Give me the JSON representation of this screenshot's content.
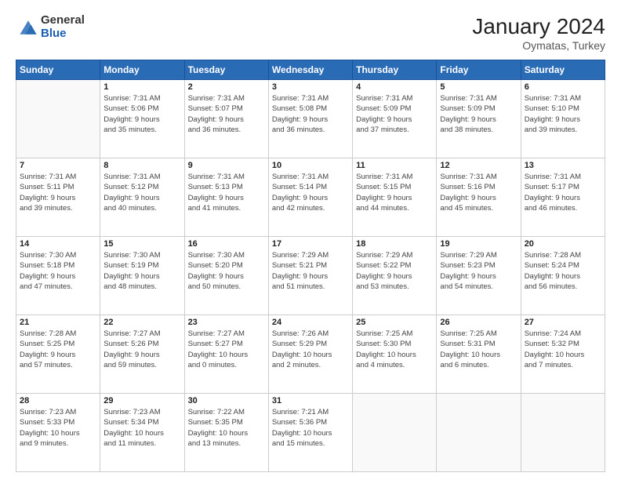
{
  "header": {
    "logo_general": "General",
    "logo_blue": "Blue",
    "main_title": "January 2024",
    "subtitle": "Oymatas, Turkey"
  },
  "days_of_week": [
    "Sunday",
    "Monday",
    "Tuesday",
    "Wednesday",
    "Thursday",
    "Friday",
    "Saturday"
  ],
  "weeks": [
    [
      {
        "day": "",
        "info": ""
      },
      {
        "day": "1",
        "info": "Sunrise: 7:31 AM\nSunset: 5:06 PM\nDaylight: 9 hours\nand 35 minutes."
      },
      {
        "day": "2",
        "info": "Sunrise: 7:31 AM\nSunset: 5:07 PM\nDaylight: 9 hours\nand 36 minutes."
      },
      {
        "day": "3",
        "info": "Sunrise: 7:31 AM\nSunset: 5:08 PM\nDaylight: 9 hours\nand 36 minutes."
      },
      {
        "day": "4",
        "info": "Sunrise: 7:31 AM\nSunset: 5:09 PM\nDaylight: 9 hours\nand 37 minutes."
      },
      {
        "day": "5",
        "info": "Sunrise: 7:31 AM\nSunset: 5:09 PM\nDaylight: 9 hours\nand 38 minutes."
      },
      {
        "day": "6",
        "info": "Sunrise: 7:31 AM\nSunset: 5:10 PM\nDaylight: 9 hours\nand 39 minutes."
      }
    ],
    [
      {
        "day": "7",
        "info": "Sunrise: 7:31 AM\nSunset: 5:11 PM\nDaylight: 9 hours\nand 39 minutes."
      },
      {
        "day": "8",
        "info": "Sunrise: 7:31 AM\nSunset: 5:12 PM\nDaylight: 9 hours\nand 40 minutes."
      },
      {
        "day": "9",
        "info": "Sunrise: 7:31 AM\nSunset: 5:13 PM\nDaylight: 9 hours\nand 41 minutes."
      },
      {
        "day": "10",
        "info": "Sunrise: 7:31 AM\nSunset: 5:14 PM\nDaylight: 9 hours\nand 42 minutes."
      },
      {
        "day": "11",
        "info": "Sunrise: 7:31 AM\nSunset: 5:15 PM\nDaylight: 9 hours\nand 44 minutes."
      },
      {
        "day": "12",
        "info": "Sunrise: 7:31 AM\nSunset: 5:16 PM\nDaylight: 9 hours\nand 45 minutes."
      },
      {
        "day": "13",
        "info": "Sunrise: 7:31 AM\nSunset: 5:17 PM\nDaylight: 9 hours\nand 46 minutes."
      }
    ],
    [
      {
        "day": "14",
        "info": "Sunrise: 7:30 AM\nSunset: 5:18 PM\nDaylight: 9 hours\nand 47 minutes."
      },
      {
        "day": "15",
        "info": "Sunrise: 7:30 AM\nSunset: 5:19 PM\nDaylight: 9 hours\nand 48 minutes."
      },
      {
        "day": "16",
        "info": "Sunrise: 7:30 AM\nSunset: 5:20 PM\nDaylight: 9 hours\nand 50 minutes."
      },
      {
        "day": "17",
        "info": "Sunrise: 7:29 AM\nSunset: 5:21 PM\nDaylight: 9 hours\nand 51 minutes."
      },
      {
        "day": "18",
        "info": "Sunrise: 7:29 AM\nSunset: 5:22 PM\nDaylight: 9 hours\nand 53 minutes."
      },
      {
        "day": "19",
        "info": "Sunrise: 7:29 AM\nSunset: 5:23 PM\nDaylight: 9 hours\nand 54 minutes."
      },
      {
        "day": "20",
        "info": "Sunrise: 7:28 AM\nSunset: 5:24 PM\nDaylight: 9 hours\nand 56 minutes."
      }
    ],
    [
      {
        "day": "21",
        "info": "Sunrise: 7:28 AM\nSunset: 5:25 PM\nDaylight: 9 hours\nand 57 minutes."
      },
      {
        "day": "22",
        "info": "Sunrise: 7:27 AM\nSunset: 5:26 PM\nDaylight: 9 hours\nand 59 minutes."
      },
      {
        "day": "23",
        "info": "Sunrise: 7:27 AM\nSunset: 5:27 PM\nDaylight: 10 hours\nand 0 minutes."
      },
      {
        "day": "24",
        "info": "Sunrise: 7:26 AM\nSunset: 5:29 PM\nDaylight: 10 hours\nand 2 minutes."
      },
      {
        "day": "25",
        "info": "Sunrise: 7:25 AM\nSunset: 5:30 PM\nDaylight: 10 hours\nand 4 minutes."
      },
      {
        "day": "26",
        "info": "Sunrise: 7:25 AM\nSunset: 5:31 PM\nDaylight: 10 hours\nand 6 minutes."
      },
      {
        "day": "27",
        "info": "Sunrise: 7:24 AM\nSunset: 5:32 PM\nDaylight: 10 hours\nand 7 minutes."
      }
    ],
    [
      {
        "day": "28",
        "info": "Sunrise: 7:23 AM\nSunset: 5:33 PM\nDaylight: 10 hours\nand 9 minutes."
      },
      {
        "day": "29",
        "info": "Sunrise: 7:23 AM\nSunset: 5:34 PM\nDaylight: 10 hours\nand 11 minutes."
      },
      {
        "day": "30",
        "info": "Sunrise: 7:22 AM\nSunset: 5:35 PM\nDaylight: 10 hours\nand 13 minutes."
      },
      {
        "day": "31",
        "info": "Sunrise: 7:21 AM\nSunset: 5:36 PM\nDaylight: 10 hours\nand 15 minutes."
      },
      {
        "day": "",
        "info": ""
      },
      {
        "day": "",
        "info": ""
      },
      {
        "day": "",
        "info": ""
      }
    ]
  ]
}
